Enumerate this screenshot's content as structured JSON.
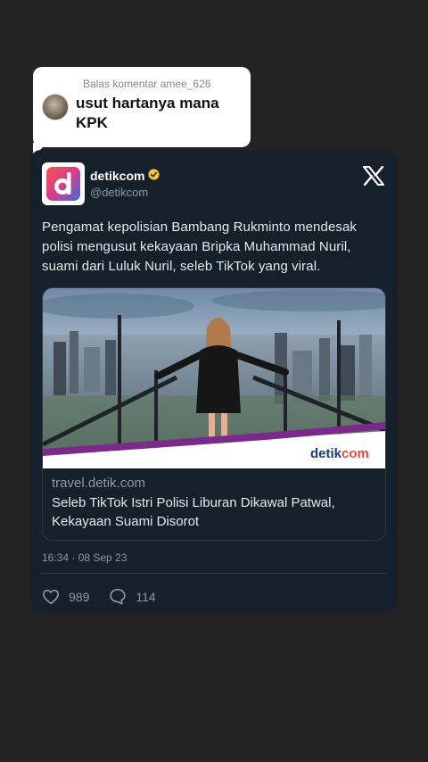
{
  "reply": {
    "header": "Balas komentar amee_626",
    "comment_line1": "usut hartanya mana",
    "comment_line2": "KPK"
  },
  "tweet": {
    "account_name": "detikcom",
    "handle": "@detikcom",
    "logo_letter": "d",
    "text": "Pengamat kepolisian Bambang Rukminto mendesak polisi mengusut kekayaan Bripka Muhammad Nuril, suami dari Luluk Nuril, seleb TikTok yang viral.",
    "link": {
      "watermark_prefix": "detik",
      "watermark_suffix": "com",
      "domain": "travel.detik.com",
      "title": "Seleb TikTok Istri Polisi Liburan Dikawal Patwal, Kekayaan Suami Disorot"
    },
    "timestamp": "16:34 · 08 Sep 23",
    "likes": "989",
    "replies": "114"
  },
  "colors": {
    "background": "#232323",
    "card": "#15202b",
    "verified": "#f6c239",
    "logo_gradient_start": "#e8416b",
    "logo_gradient_end": "#3b6fd8"
  },
  "icons": [
    "verified-badge-icon",
    "x-logo-icon",
    "heart-icon",
    "comment-icon"
  ]
}
